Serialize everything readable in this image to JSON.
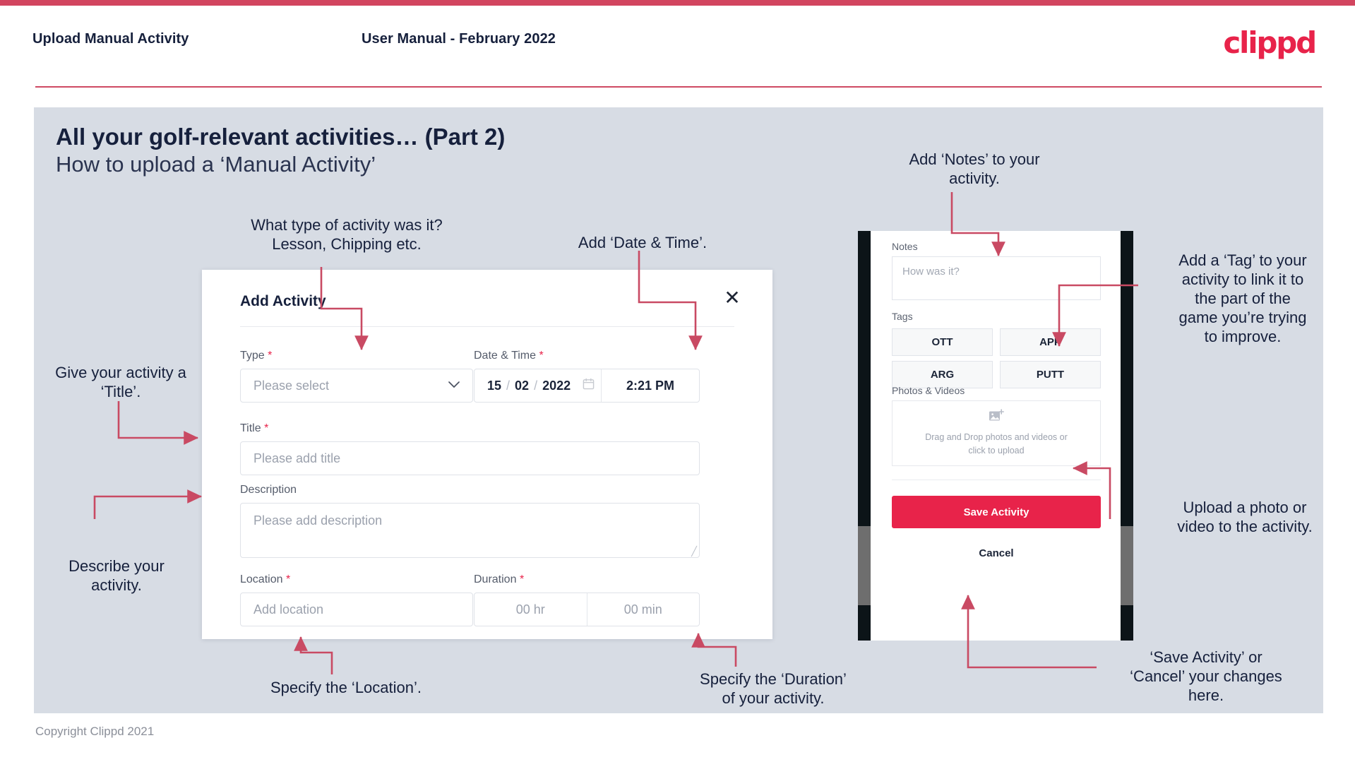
{
  "header": {
    "title": "Upload Manual Activity",
    "subtitle": "User Manual - February 2022",
    "logo": "clippd"
  },
  "slide": {
    "heading": "All your golf-relevant activities… (Part 2)",
    "subheading": "How to upload a ‘Manual Activity’",
    "footer": "Copyright Clippd 2021"
  },
  "dialog": {
    "title": "Add Activity",
    "close_icon": "close-icon",
    "fields": {
      "type": {
        "label": "Type",
        "required": "*",
        "placeholder": "Please select"
      },
      "datetime": {
        "label": "Date & Time",
        "required": "*",
        "day": "15",
        "month": "02",
        "year": "2022",
        "sep": "/",
        "time": "2:21 PM",
        "calendar_icon": "calendar-icon"
      },
      "title": {
        "label": "Title",
        "required": "*",
        "placeholder": "Please add title"
      },
      "description": {
        "label": "Description",
        "placeholder": "Please add description"
      },
      "location": {
        "label": "Location",
        "required": "*",
        "placeholder": "Add location"
      },
      "duration": {
        "label": "Duration",
        "required": "*",
        "hours": "00 hr",
        "minutes": "00 min"
      }
    }
  },
  "phone": {
    "notes": {
      "label": "Notes",
      "placeholder": "How was it?"
    },
    "tags": {
      "label": "Tags",
      "items": [
        "OTT",
        "APP",
        "ARG",
        "PUTT"
      ]
    },
    "photos": {
      "label": "Photos & Videos",
      "icon": "add-image-icon",
      "line1": "Drag and Drop photos and videos or",
      "line2": "click to upload"
    },
    "save_label": "Save Activity",
    "cancel_label": "Cancel"
  },
  "annotations": {
    "type": "What type of activity was it?\nLesson, Chipping etc.",
    "datetime": "Add ‘Date & Time’.",
    "title": "Give your activity a\n‘Title’.",
    "description": "Describe your\nactivity.",
    "location": "Specify the ‘Location’.",
    "duration": "Specify the ‘Duration’\nof your activity.",
    "notes": "Add ‘Notes’ to your\nactivity.",
    "tags": "Add a ‘Tag’ to your\nactivity to link it to\nthe part of the\ngame you’re trying\nto improve.",
    "photos": "Upload a photo or\nvideo to the activity.",
    "save": "‘Save Activity’ or\n‘Cancel’ your changes\nhere."
  },
  "colors": {
    "brand": "#e8234a",
    "top_bar": "#d2455f",
    "slide_bg": "#d7dce4",
    "arrow": "#c94a63",
    "text": "#16203c"
  }
}
